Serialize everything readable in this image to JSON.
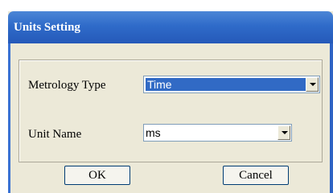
{
  "dialog": {
    "title": "Units Setting"
  },
  "fields": {
    "metrology_type_label": "Metrology Type",
    "metrology_type_value": "Time",
    "unit_name_label": "Unit Name",
    "unit_name_value": "ms"
  },
  "buttons": {
    "ok_label": "OK",
    "cancel_label": "Cancel"
  },
  "icons": {
    "dropdown": "chevron-down-icon"
  },
  "colors": {
    "titlebar": "#2f6bc9",
    "selection": "#316ac5",
    "dialog_bg": "#ece9d8"
  }
}
